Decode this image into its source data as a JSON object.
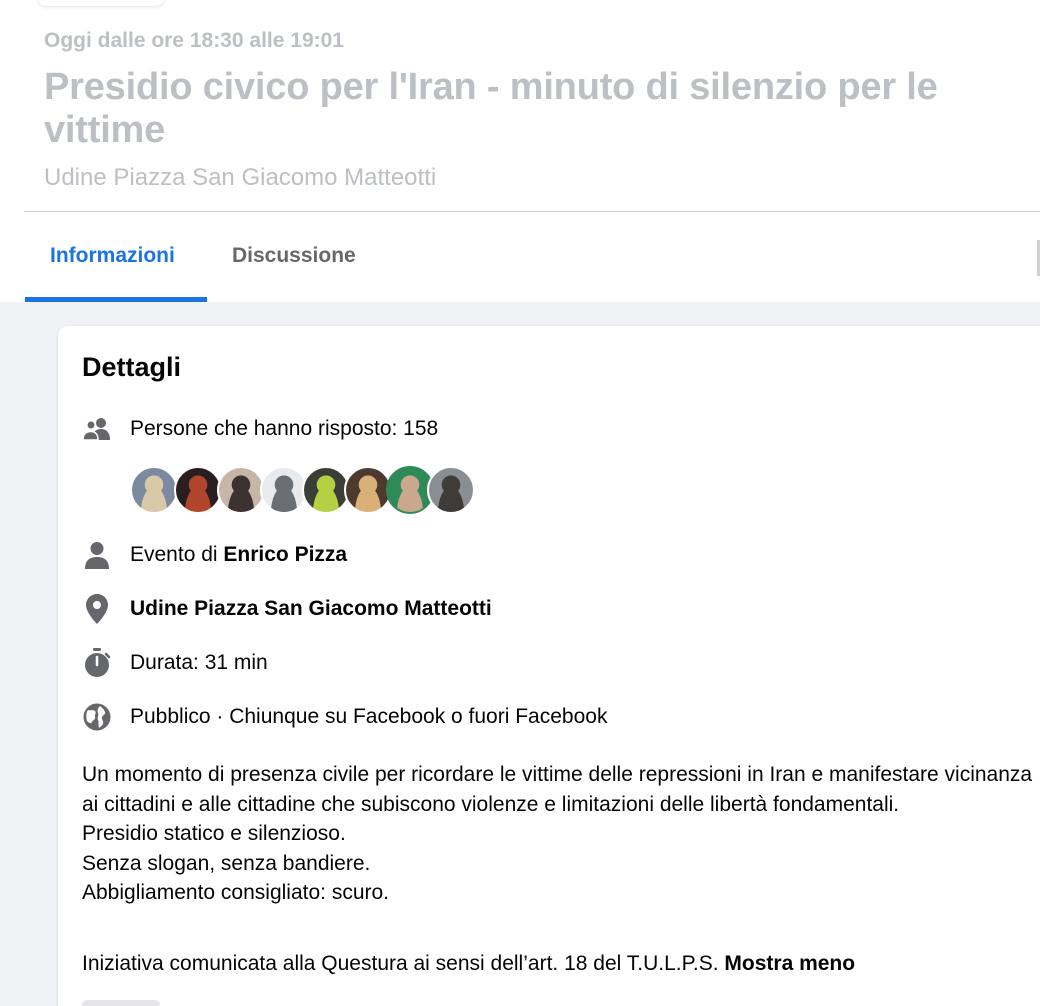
{
  "event": {
    "date_line": "Oggi dalle ore 18:30 alle 19:01",
    "title": "Presidio civico per l'Iran - minuto di silenzio per le vittime",
    "location": "Udine Piazza San Giacomo Matteotti"
  },
  "tabs": [
    {
      "label": "Informazioni",
      "active": true
    },
    {
      "label": "Discussione",
      "active": false
    }
  ],
  "details": {
    "heading": "Dettagli",
    "responses": "Persone che hanno risposto: 158",
    "organizer_prefix": "Evento di ",
    "organizer_name": "Enrico Pizza",
    "place": "Udine Piazza San Giacomo Matteotti",
    "duration": "Durata: 31 min",
    "privacy": "Pubblico · Chiunque su Facebook o fuori Facebook",
    "icons": [
      "people-icon",
      "person-icon",
      "location-pin-icon",
      "stopwatch-icon",
      "globe-icon"
    ]
  },
  "attendees": [
    {
      "colors": [
        "#7c8aa0",
        "#d9c9a8"
      ]
    },
    {
      "colors": [
        "#2a1d1f",
        "#b0452c"
      ]
    },
    {
      "colors": [
        "#c7b5a6",
        "#3c3230"
      ]
    },
    {
      "colors": [
        "#e8ebee",
        "#6a6f75"
      ]
    },
    {
      "colors": [
        "#3b3e36",
        "#b7d043"
      ]
    },
    {
      "colors": [
        "#4b3a2d",
        "#d9b178"
      ]
    },
    {
      "colors": [
        "#2e8b57",
        "#c9a88e"
      ]
    },
    {
      "colors": [
        "#8a8d92",
        "#3f3b38"
      ]
    }
  ],
  "description": {
    "lines": [
      "Un momento di presenza civile per ricordare le vittime delle repressioni in Iran e manifestare vicinanza ai cittadini e alle cittadine che subiscono violenze e limitazioni delle libertà fondamentali.",
      "Presidio statico e silenzioso.",
      "Senza slogan, senza bandiere.",
      "Abbigliamento consigliato: scuro."
    ],
    "last_line": "Iniziativa comunicata alla Questura ai sensi dell’art. 18 del T.U.L.P.S. ",
    "toggle_label": "Mostra meno"
  },
  "colors": {
    "accent": "#1b74e4",
    "muted_text": "#bcc0c4",
    "secondary_text": "#65676b",
    "icon": "#65676b"
  }
}
